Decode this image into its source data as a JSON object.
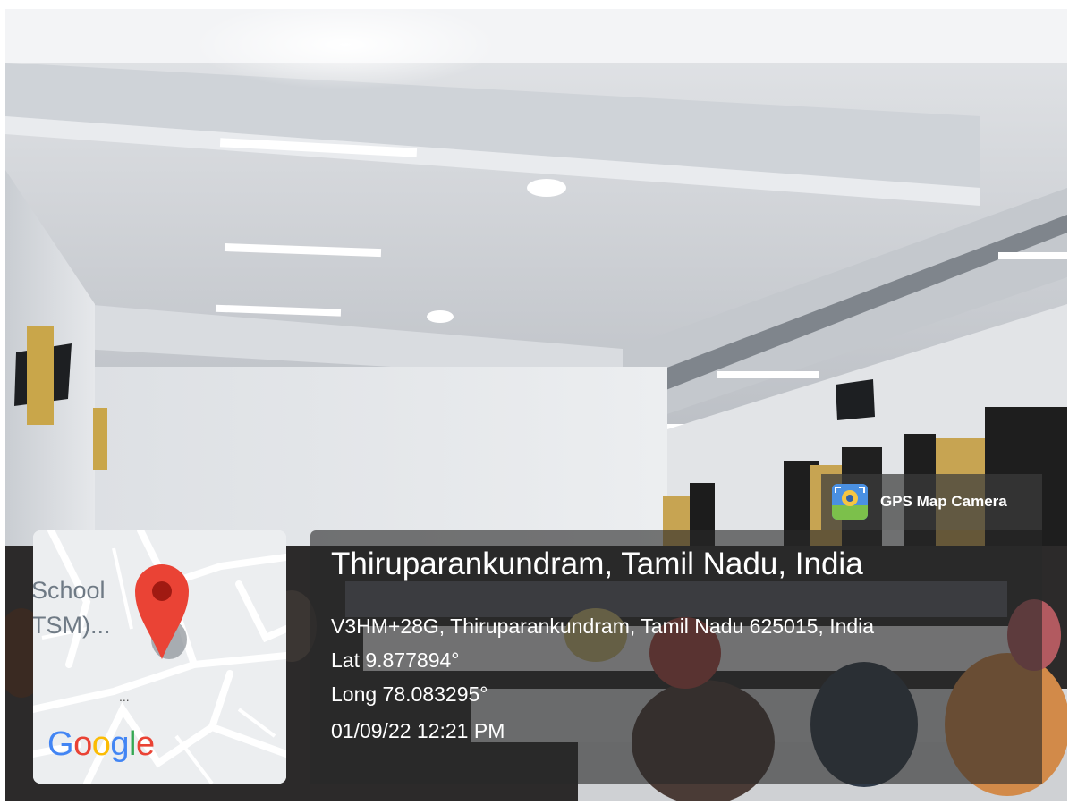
{
  "map": {
    "label_line1": "School",
    "label_line2": "TSM)...",
    "ellipsis": "...",
    "logo_letters": [
      "G",
      "o",
      "o",
      "g",
      "l",
      "e"
    ],
    "pin_color": "#ea4335",
    "pin_icon": "map-pin-icon"
  },
  "badge": {
    "app_name": "GPS Map Camera",
    "icon": "gps-map-camera-icon"
  },
  "info": {
    "title": "Thiruparankundram, Tamil Nadu, India",
    "address": "V3HM+28G, Thiruparankundram, Tamil Nadu 625015, India",
    "lat": "Lat 9.877894°",
    "long": "Long 78.083295°",
    "datetime": "01/09/22 12:21 PM"
  }
}
